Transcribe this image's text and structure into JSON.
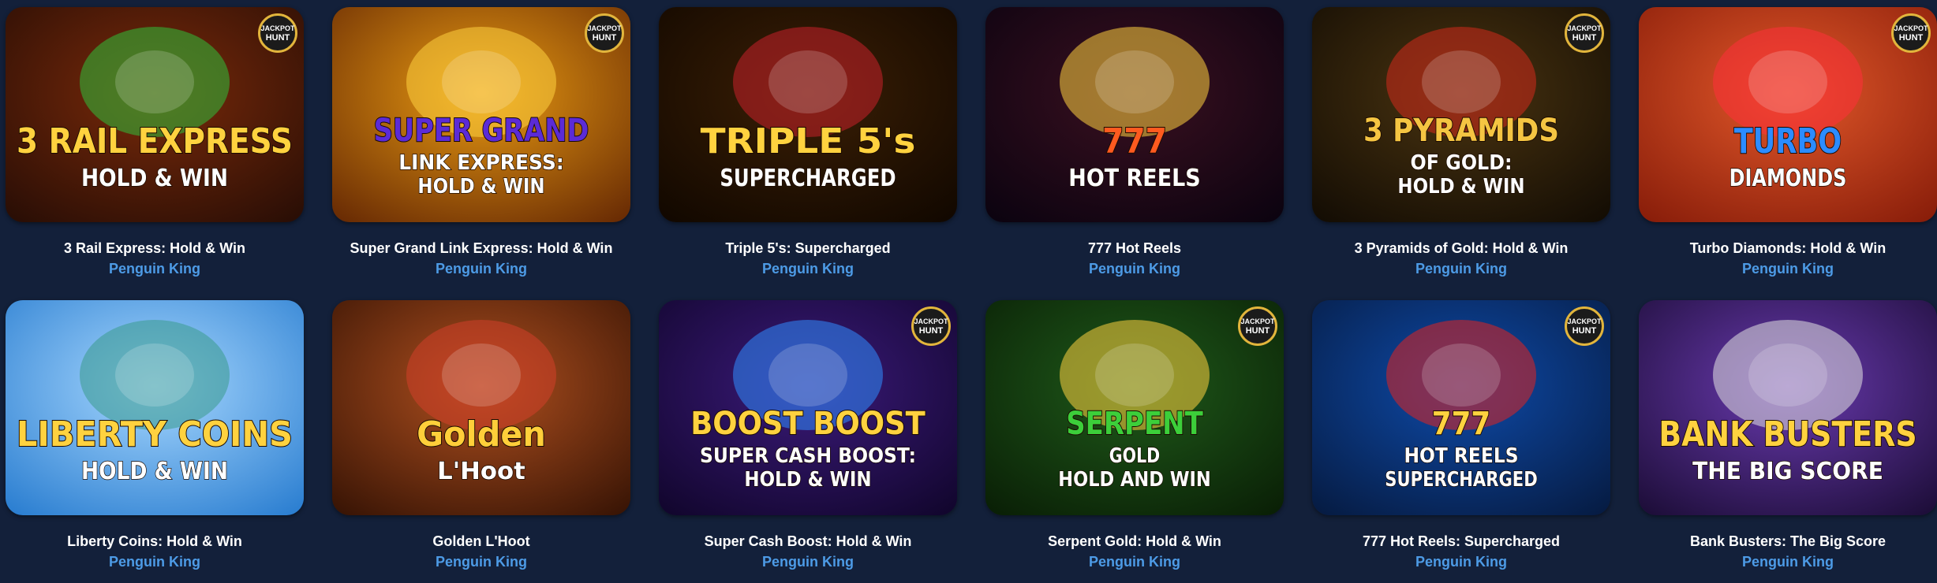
{
  "games": [
    {
      "title": "3 Rail Express: Hold & Win",
      "provider": "Penguin King",
      "art_lines": [
        "3 RAIL EXPRESS",
        "HOLD & WIN"
      ],
      "badge": [
        "JACKPOT",
        "HUNT"
      ],
      "colors": {
        "bg1": "#7a2a0a",
        "bg2": "#2a0e05",
        "text": "#ffd23f",
        "accent": "#2fbf3a"
      }
    },
    {
      "title": "Super Grand Link Express: Hold & Win",
      "provider": "Penguin King",
      "art_lines": [
        "SUPER GRAND",
        "LINK EXPRESS:",
        "HOLD & WIN"
      ],
      "badge": [
        "JACKPOT",
        "HUNT"
      ],
      "colors": {
        "bg1": "#e89a12",
        "bg2": "#6a2c04",
        "text": "#5b2bd6",
        "accent": "#ffd23f"
      }
    },
    {
      "title": "Triple 5's: Supercharged",
      "provider": "Penguin King",
      "art_lines": [
        "TRIPLE 5's",
        "SUPERCHARGED"
      ],
      "badge": null,
      "colors": {
        "bg1": "#3b1f05",
        "bg2": "#120800",
        "text": "#ffd23f",
        "accent": "#c8202a"
      }
    },
    {
      "title": "777 Hot Reels",
      "provider": "Penguin King",
      "art_lines": [
        "777",
        "HOT REELS"
      ],
      "badge": null,
      "colors": {
        "bg1": "#3a1020",
        "bg2": "#0c0310",
        "text": "#ff5a1f",
        "accent": "#ffd23f"
      }
    },
    {
      "title": "3 Pyramids of Gold: Hold & Win",
      "provider": "Penguin King",
      "art_lines": [
        "3 PYRAMIDS",
        "OF GOLD:",
        "HOLD & WIN"
      ],
      "badge": [
        "JACKPOT",
        "HUNT"
      ],
      "colors": {
        "bg1": "#4a3410",
        "bg2": "#140d04",
        "text": "#f5c542",
        "accent": "#d22a1c"
      }
    },
    {
      "title": "Turbo Diamonds: Hold & Win",
      "provider": "Penguin King",
      "art_lines": [
        "TURBO",
        "DIAMONDS"
      ],
      "badge": [
        "JACKPOT",
        "HUNT"
      ],
      "colors": {
        "bg1": "#e2582a",
        "bg2": "#8a1e0a",
        "text": "#2c8cff",
        "accent": "#ff2f3a"
      }
    },
    {
      "title": "Liberty Coins: Hold & Win",
      "provider": "Penguin King",
      "art_lines": [
        "LIBERTY COINS",
        "HOLD & WIN"
      ],
      "badge": null,
      "colors": {
        "bg1": "#a8d8ff",
        "bg2": "#2c7fd1",
        "text": "#ffd23f",
        "accent": "#3a9a8c"
      }
    },
    {
      "title": "Golden L'Hoot",
      "provider": "Penguin King",
      "art_lines": [
        "Golden",
        "L'Hoot"
      ],
      "badge": null,
      "colors": {
        "bg1": "#b0501f",
        "bg2": "#3a1505",
        "text": "#ffcf3a",
        "accent": "#d2402a"
      }
    },
    {
      "title": "Super Cash Boost: Hold & Win",
      "provider": "Penguin King",
      "art_lines": [
        "BOOST  BOOST",
        "SUPER CASH BOOST:",
        "HOLD & WIN"
      ],
      "badge": [
        "JACKPOT",
        "HUNT"
      ],
      "colors": {
        "bg1": "#3b1a7a",
        "bg2": "#12062e",
        "text": "#ffd23f",
        "accent": "#2f8cff"
      }
    },
    {
      "title": "Serpent Gold: Hold & Win",
      "provider": "Penguin King",
      "art_lines": [
        "SERPENT",
        "GOLD",
        "HOLD AND WIN"
      ],
      "badge": [
        "JACKPOT",
        "HUNT"
      ],
      "colors": {
        "bg1": "#1f5a1a",
        "bg2": "#0a2006",
        "text": "#3ccf3a",
        "accent": "#ffd23f"
      }
    },
    {
      "title": "777 Hot Reels: Supercharged",
      "provider": "Penguin King",
      "art_lines": [
        "777",
        "HOT REELS",
        "SUPERCHARGED"
      ],
      "badge": [
        "JACKPOT",
        "HUNT"
      ],
      "colors": {
        "bg1": "#0e4aa8",
        "bg2": "#061c44",
        "text": "#ffd23f",
        "accent": "#e2231f"
      }
    },
    {
      "title": "Bank Busters: The Big Score",
      "provider": "Penguin King",
      "art_lines": [
        "BANK BUSTERS",
        "THE BIG SCORE"
      ],
      "badge": null,
      "colors": {
        "bg1": "#6a3ab0",
        "bg2": "#1e0e3a",
        "text": "#ffd23f",
        "accent": "#e2e2e2"
      }
    }
  ]
}
